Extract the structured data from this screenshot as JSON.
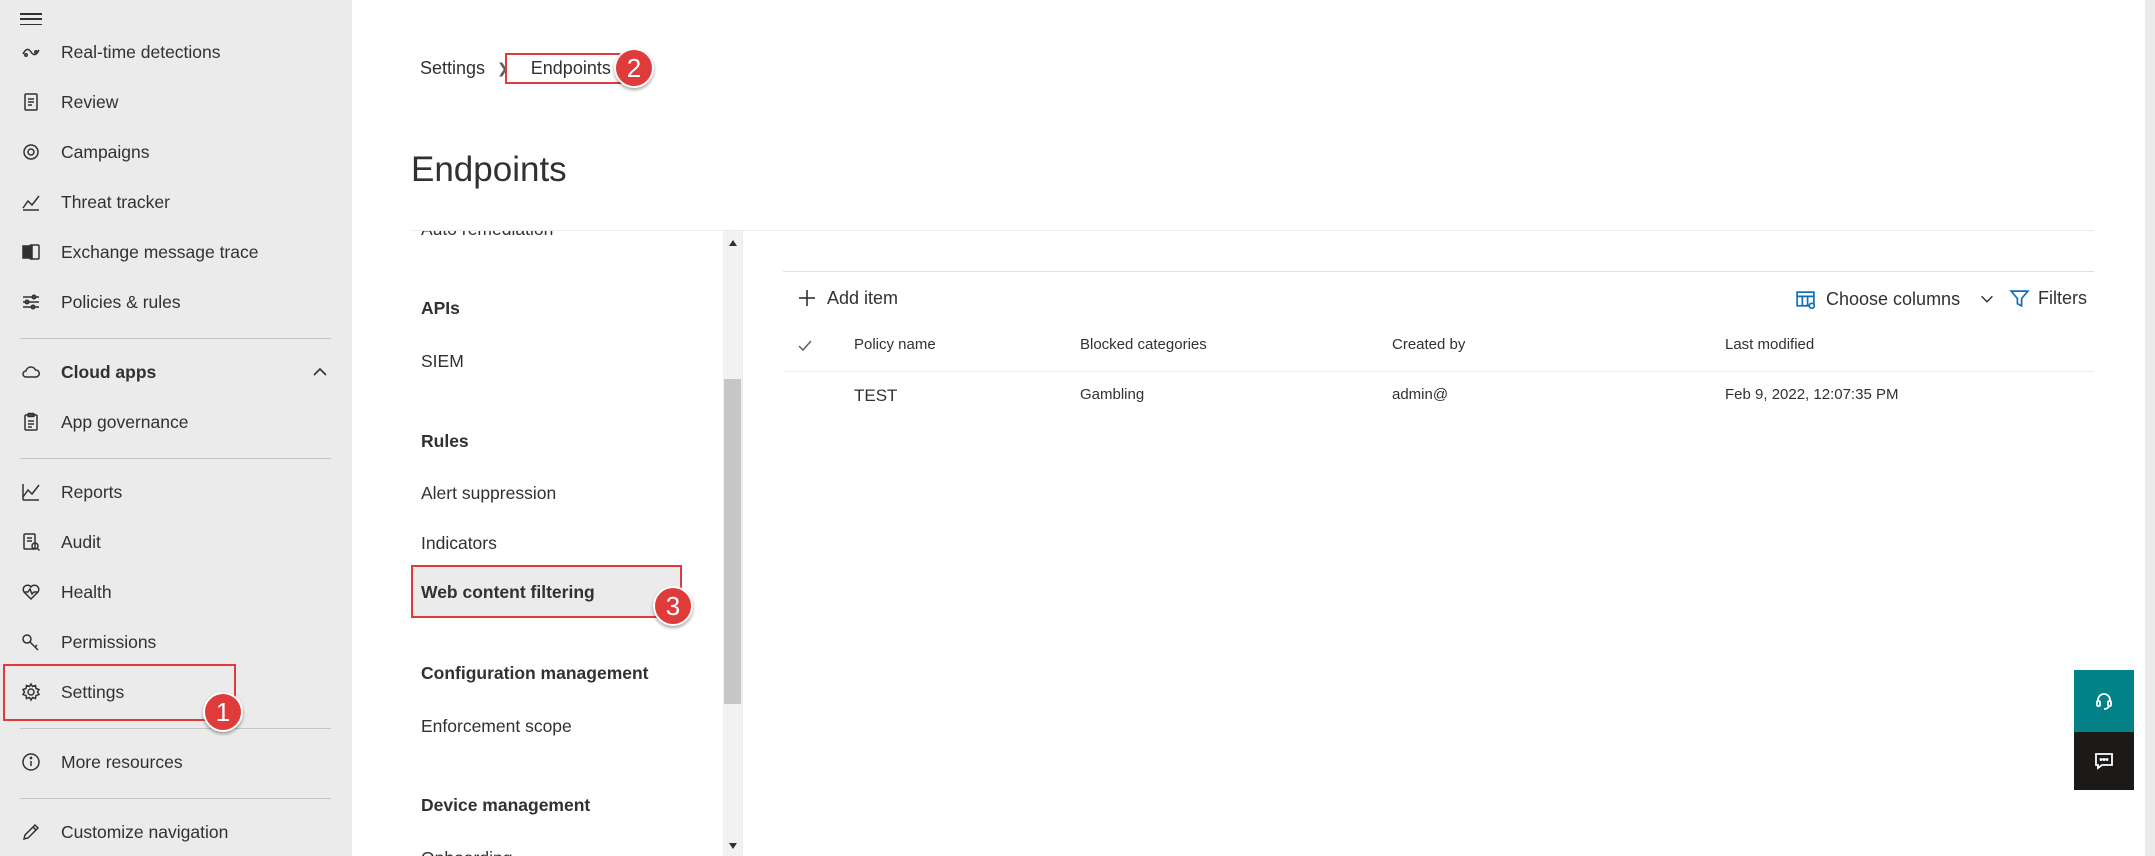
{
  "nav": {
    "items": [
      {
        "label": "Real-time detections",
        "icon": "realtime-detections-icon"
      },
      {
        "label": "Review",
        "icon": "review-icon"
      },
      {
        "label": "Campaigns",
        "icon": "campaigns-icon"
      },
      {
        "label": "Threat tracker",
        "icon": "threat-tracker-icon"
      },
      {
        "label": "Exchange message trace",
        "icon": "exchange-icon"
      },
      {
        "label": "Policies & rules",
        "icon": "policies-icon"
      },
      {
        "label": "Cloud apps",
        "icon": "cloud-icon"
      },
      {
        "label": "App governance",
        "icon": "app-governance-icon"
      },
      {
        "label": "Reports",
        "icon": "reports-icon"
      },
      {
        "label": "Audit",
        "icon": "audit-icon"
      },
      {
        "label": "Health",
        "icon": "health-icon"
      },
      {
        "label": "Permissions",
        "icon": "permissions-icon"
      },
      {
        "label": "Settings",
        "icon": "gear-icon"
      },
      {
        "label": "More resources",
        "icon": "info-icon"
      },
      {
        "label": "Customize navigation",
        "icon": "pencil-icon"
      }
    ]
  },
  "breadcrumb": {
    "root": "Settings",
    "current": "Endpoints"
  },
  "page": {
    "title": "Endpoints"
  },
  "subnav": {
    "partial_item": "Auto remediation",
    "sections": [
      {
        "heading": "APIs",
        "items": [
          "SIEM"
        ]
      },
      {
        "heading": "Rules",
        "items": [
          "Alert suppression",
          "Indicators",
          "Web content filtering"
        ]
      },
      {
        "heading": "Configuration management",
        "items": [
          "Enforcement scope"
        ]
      },
      {
        "heading": "Device management",
        "items": [
          "Onboarding"
        ]
      }
    ]
  },
  "toolbar": {
    "add_item": "Add item",
    "choose_columns": "Choose columns",
    "filters": "Filters"
  },
  "table": {
    "columns": [
      "Policy name",
      "Blocked categories",
      "Created by",
      "Last modified"
    ],
    "rows": [
      {
        "policy_name": "TEST",
        "blocked_categories": "Gambling",
        "created_by": "admin@",
        "last_modified": "Feb 9, 2022, 12:07:35 PM"
      }
    ]
  },
  "annotations": [
    "1",
    "2",
    "3"
  ],
  "colors": {
    "nav_bg": "#ebebeb",
    "annotation_red": "#e03b3b",
    "help_teal": "#038387",
    "chat_dark": "#1b1a19"
  }
}
